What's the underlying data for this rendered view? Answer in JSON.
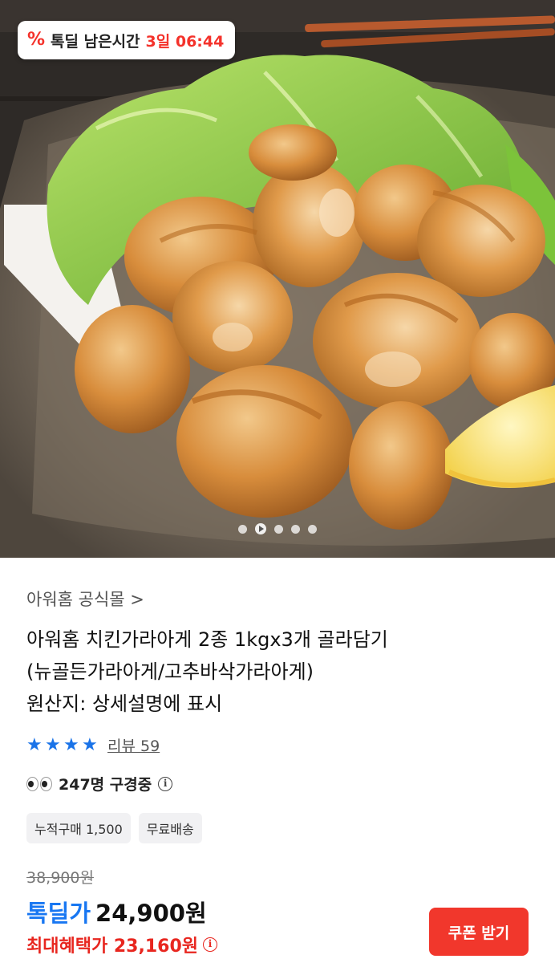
{
  "deal_badge": {
    "icon": "percent-icon",
    "label": "톡딜 남은시간",
    "time_left": "3일 06:44"
  },
  "gallery": {
    "image": "fried-chicken-karaage-photo",
    "indicator": [
      "dot",
      "play",
      "dot",
      "dot",
      "dot"
    ]
  },
  "product": {
    "store_link": "아워홈 공식몰 >",
    "title_lines": [
      "아워홈 치킨가라아게 2종 1kgx3개 골라담기",
      "(뉴골든가라아게/고추바삭가라아게)",
      "원산지: 상세설명에 표시"
    ],
    "rating_stars": 4,
    "review_link": "리뷰 59",
    "viewers": "247명 구경중",
    "tags": [
      "누적구매 1,500",
      "무료배송"
    ]
  },
  "pricing": {
    "original_price": "38,900원",
    "deal_label": "톡딜가",
    "deal_price": "24,900원",
    "max_benefit": "최대혜택가 23,160원",
    "coupon_button": "쿠폰 받기"
  },
  "colors": {
    "accent_red": "#f4322b",
    "accent_blue": "#1877f2",
    "star_blue": "#1a73e8"
  }
}
